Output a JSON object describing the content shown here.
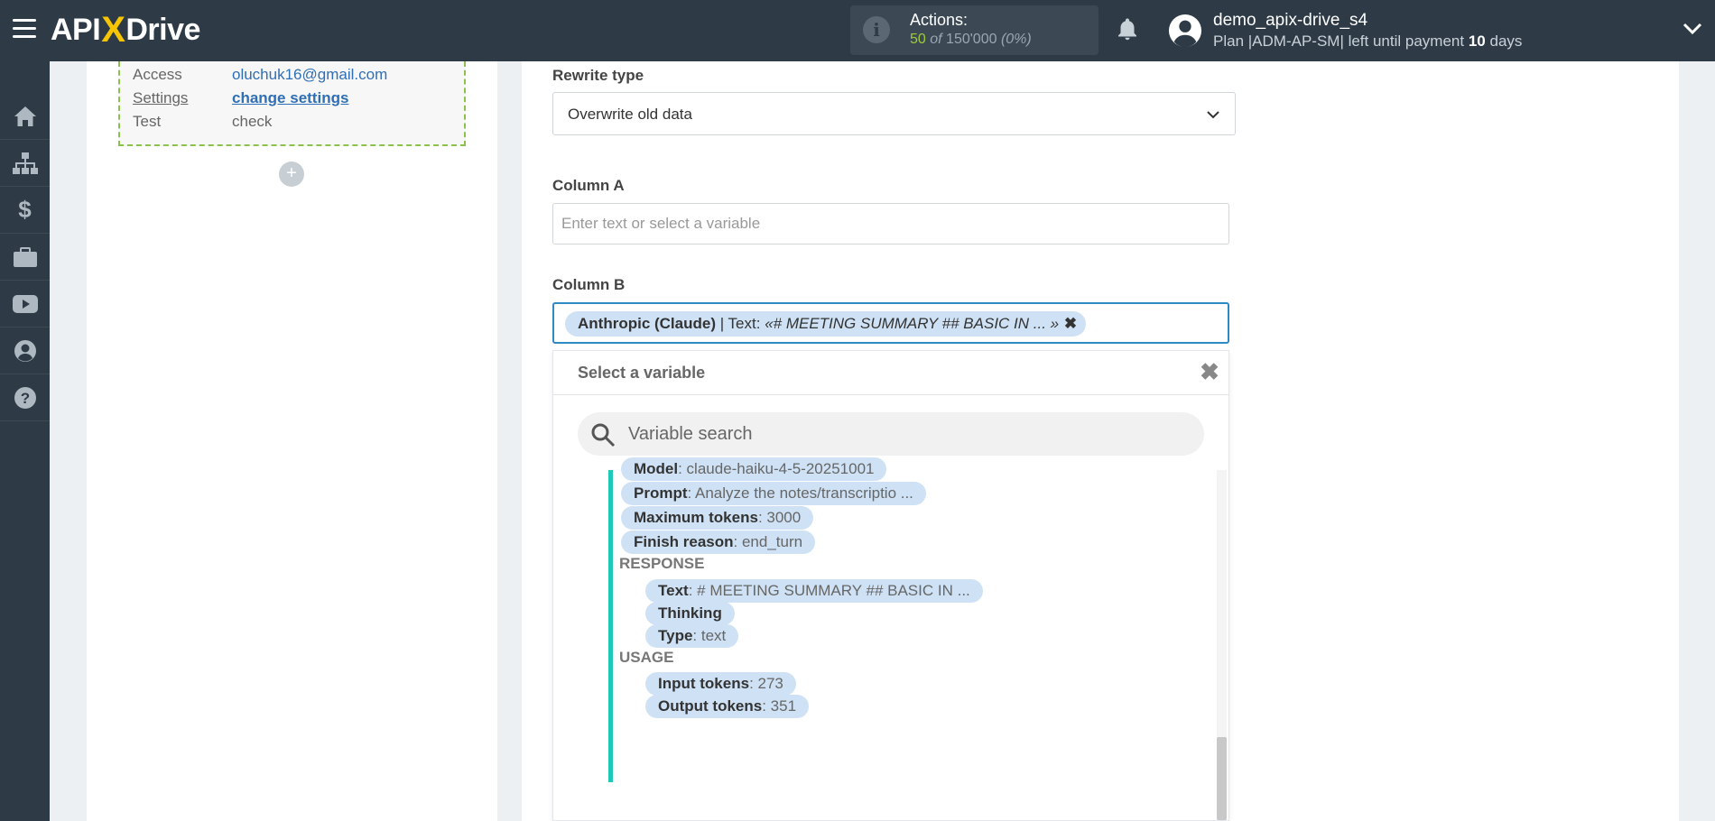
{
  "header": {
    "logo_left": "API",
    "logo_x": "X",
    "logo_right": "Drive",
    "actions_label": "Actions:",
    "actions_used": "50",
    "actions_of": "of",
    "actions_total": "150'000",
    "actions_percent": "(0%)",
    "user_name": "demo_apix-drive_s4",
    "plan_text": "Plan |ADM-AP-SM| left until payment",
    "plan_days": "10",
    "plan_days_suffix": "days"
  },
  "sidebar": {
    "items": [
      "home-icon",
      "sitemap-icon",
      "dollar-icon",
      "briefcase-icon",
      "youtube-icon",
      "user-icon",
      "help-icon"
    ]
  },
  "card": {
    "rows": [
      {
        "key": "Access",
        "value": "oluchuk16@gmail.com"
      },
      {
        "key": "Settings",
        "value": "change settings"
      },
      {
        "key": "Test",
        "value": "check"
      }
    ],
    "add_label": "+"
  },
  "form": {
    "rewrite_label": "Rewrite type",
    "rewrite_value": "Overwrite old data",
    "col_a_label": "Column A",
    "col_a_placeholder": "Enter text or select a variable",
    "col_b_label": "Column B",
    "col_b_chip_source": "Anthropic (Claude)",
    "col_b_chip_sep": " | Text: ",
    "col_b_chip_value": "«# MEETING SUMMARY ## BASIC IN ... »",
    "col_b_chip_remove": "✖"
  },
  "dropdown": {
    "title": "Select a variable",
    "close": "✖",
    "search_placeholder": "Variable search",
    "vars": [
      {
        "key": "Model",
        "value": ": claude-haiku-4-5-20251001"
      },
      {
        "key": "Prompt",
        "value": ": Analyze the notes/transcriptio ..."
      },
      {
        "key": "Maximum tokens",
        "value": ": 3000"
      },
      {
        "key": "Finish reason",
        "value": ": end_turn"
      }
    ],
    "response_label": "RESPONSE",
    "response_vars": [
      {
        "key": "Text",
        "value": ": # MEETING SUMMARY ## BASIC IN ..."
      },
      {
        "key": "Thinking",
        "value": ""
      },
      {
        "key": "Type",
        "value": ": text"
      }
    ],
    "usage_label": "USAGE",
    "usage_vars": [
      {
        "key": "Input tokens",
        "value": ": 273"
      },
      {
        "key": "Output tokens",
        "value": ": 351"
      }
    ]
  }
}
